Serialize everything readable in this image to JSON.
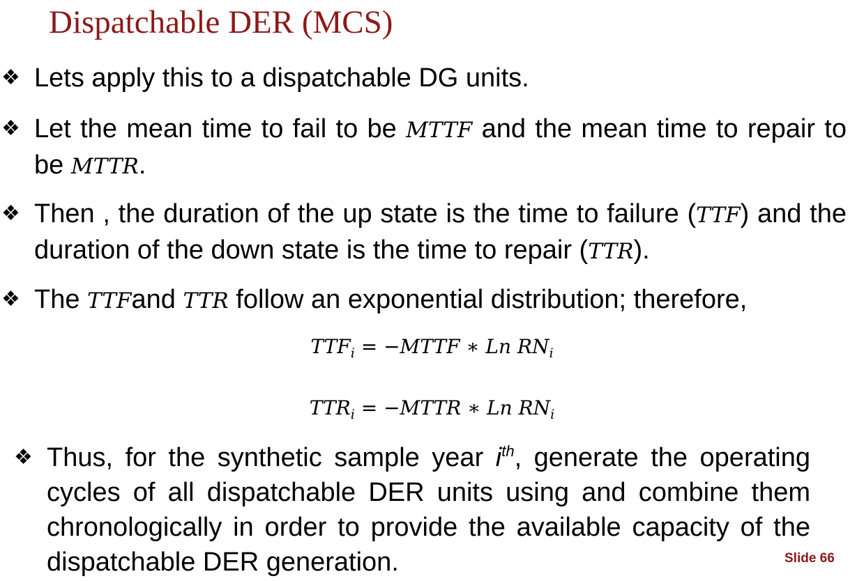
{
  "title": "Dispatchable DER (MCS)",
  "colors": {
    "title": "#8b1a1a",
    "slide_number": "#8b1a1a",
    "text": "#000000"
  },
  "bullet_icon": "diamond-bullet-icon",
  "bullet_glyph": "❖",
  "bullets": [
    {
      "text": "Lets apply this to a dispatchable DG units."
    },
    {
      "text_a": "Let the mean time to fail to be ",
      "math_a": "MTTF",
      "text_b": " and the mean time to repair to be ",
      "math_b": "MTTR",
      "text_c": "."
    },
    {
      "text_a": "Then , the duration of the up state is the  time to failure (",
      "math_a": "TTF",
      "text_b": ") and the duration of the down state is the time to repair (",
      "math_b": "TTR",
      "text_c": ")."
    },
    {
      "text_a": "The ",
      "math_a": "TTF",
      "text_b": "and ",
      "math_b": "TTR",
      "text_c": " follow an exponential distribution; therefore,"
    },
    {
      "text_a": "Thus, for the synthetic sample year ",
      "sup_base": "i",
      "sup": "th",
      "text_b": ", generate the operating cycles of all dispatchable DER units using and combine them chronologically in order to provide the available capacity of the dispatchable DER generation."
    }
  ],
  "equations": [
    {
      "lhs": "TTF",
      "lhs_sub": "i",
      "eq": " = −",
      "term": "MTTF",
      "op": " ∗ ",
      "fn": "Ln",
      "var": " RN",
      "var_sub": "i"
    },
    {
      "lhs": "TTR",
      "lhs_sub": "i",
      "eq": " = −",
      "term": "MTTR",
      "op": " ∗ ",
      "fn": "Ln",
      "var": " RN",
      "var_sub": "i"
    }
  ],
  "slide_number": "Slide 66"
}
